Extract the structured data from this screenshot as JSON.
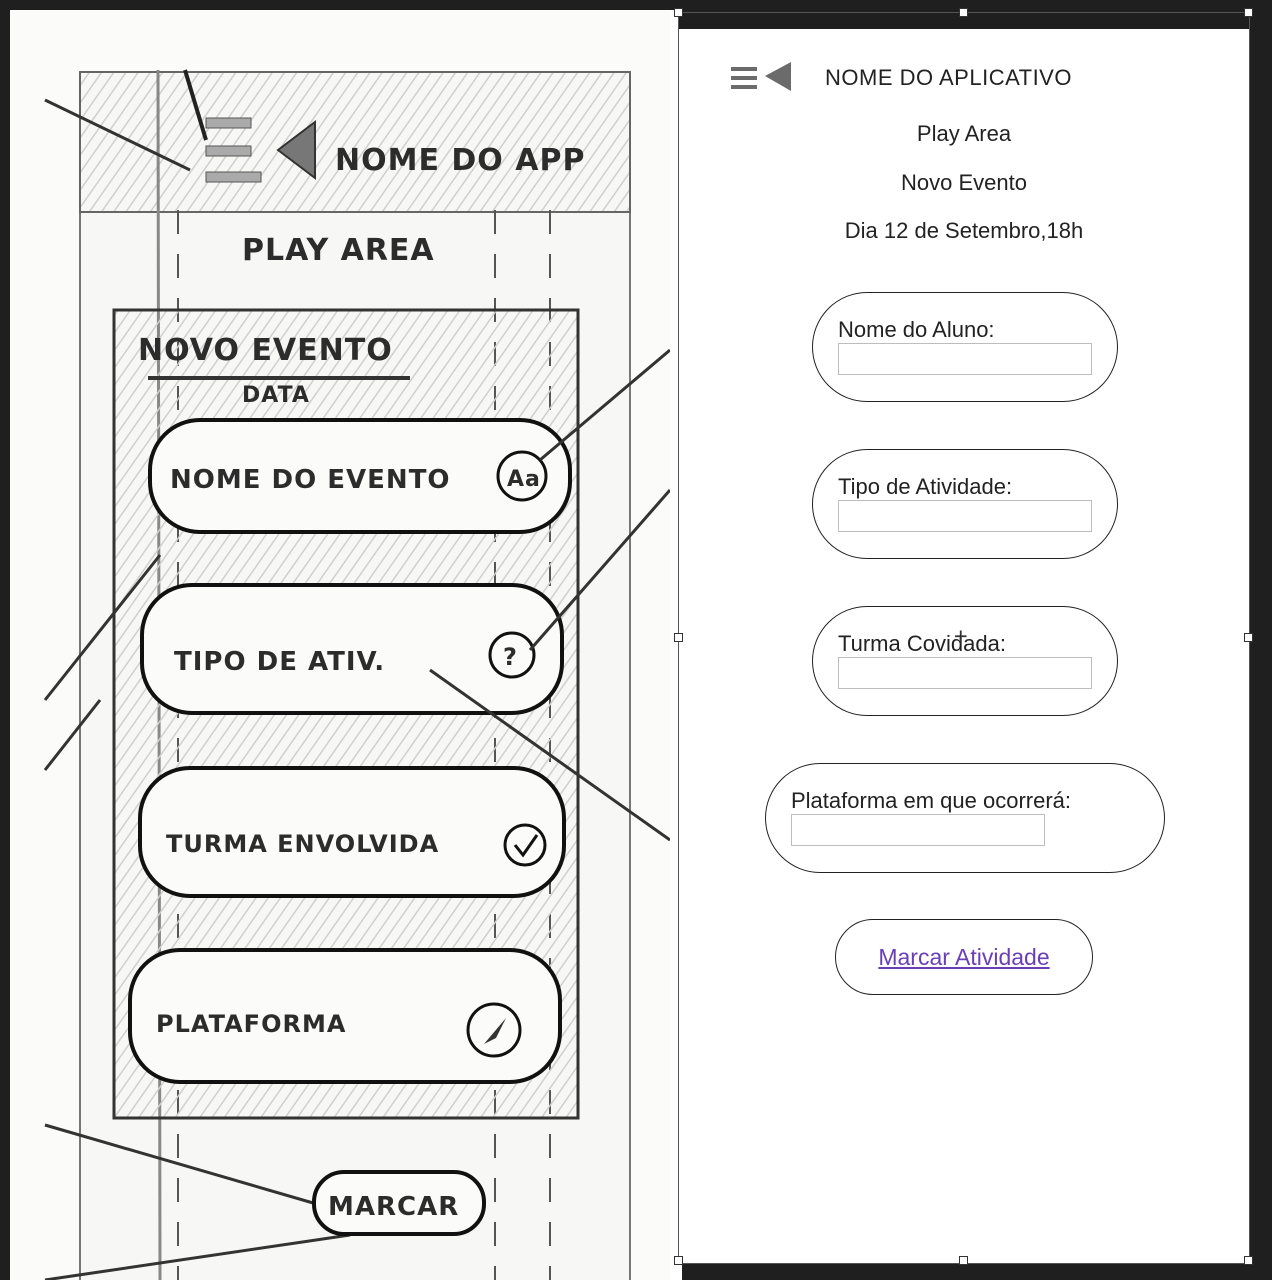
{
  "sketch": {
    "header_text": "NOME DO APP",
    "play_area": "PLAY AREA",
    "event_title": "NOVO EVENTO",
    "date_label": "DATA",
    "fields": [
      {
        "label": "NOME DO EVENTO",
        "icon": "Aa"
      },
      {
        "label": "TIPO DE ATIV.",
        "icon": "?"
      },
      {
        "label": "TURMA ENVOLVIDA",
        "icon": "check"
      },
      {
        "label": "PLATAFORMA",
        "icon": "pointer"
      }
    ],
    "button_label": "MARCAR"
  },
  "app": {
    "title": "NOME DO APLICATIVO",
    "menu_icon": "menu-back-icon",
    "play_area": "Play Area",
    "event_title": "Novo Evento",
    "date": "Dia 12 de Setembro,18h",
    "fields": [
      {
        "label": "Nome do Aluno:",
        "value": ""
      },
      {
        "label": "Tipo de Atividade:",
        "value": ""
      },
      {
        "label": "Turma Co",
        "label_rest": "vidada:",
        "value": ""
      },
      {
        "label": "Plataforma em que ocorrerá:",
        "value": ""
      }
    ],
    "action_label": "Marcar Atividade",
    "link_color": "#6a3fb5"
  }
}
